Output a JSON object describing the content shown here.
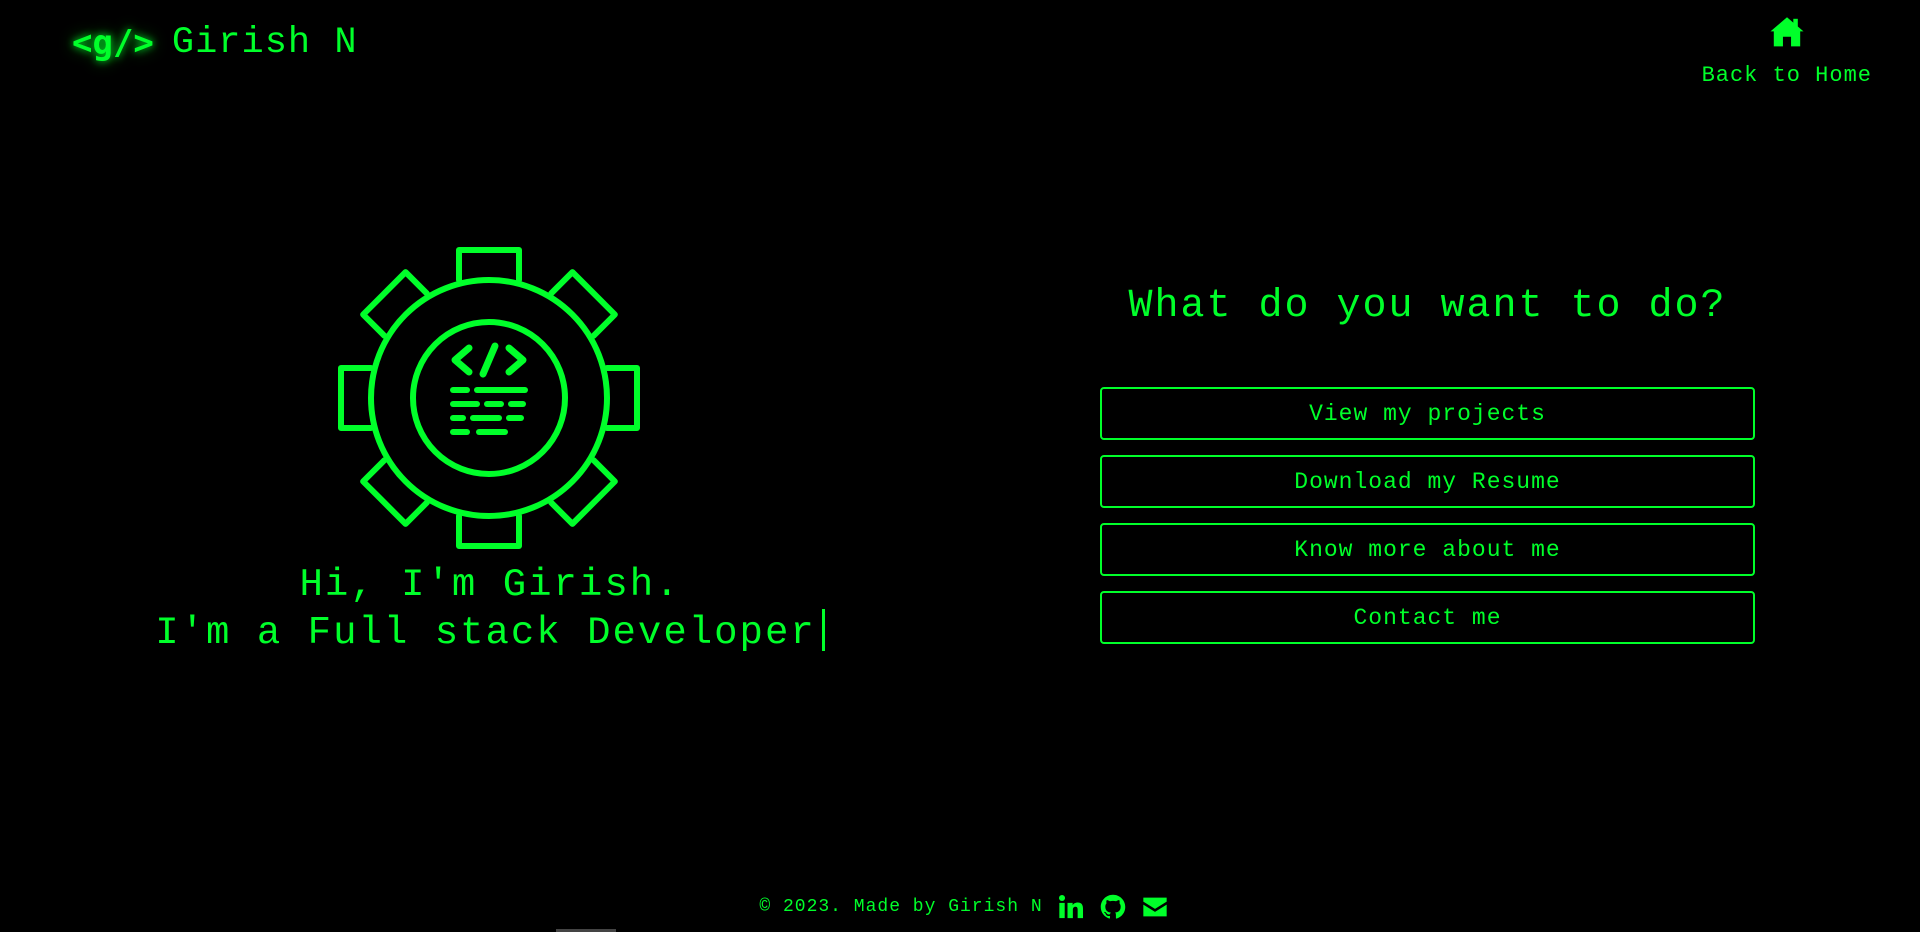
{
  "header": {
    "logo": "<g/>",
    "name": "Girish N",
    "home_icon": "home-icon",
    "home_label": "Back to Home"
  },
  "hero": {
    "illustration": "code-gear-icon",
    "line1": "Hi, I'm Girish.",
    "line2": "I'm a Full stack Developer"
  },
  "actions": {
    "question": "What do you want to do?",
    "buttons": [
      "View my projects",
      "Download my Resume",
      "Know more about me",
      "Contact me"
    ]
  },
  "footer": {
    "text": "© 2023. Made by Girish N",
    "icons": [
      "linkedin-icon",
      "github-icon",
      "email-icon"
    ]
  },
  "colors": {
    "background": "#000000",
    "accent": "#00ff2a"
  }
}
